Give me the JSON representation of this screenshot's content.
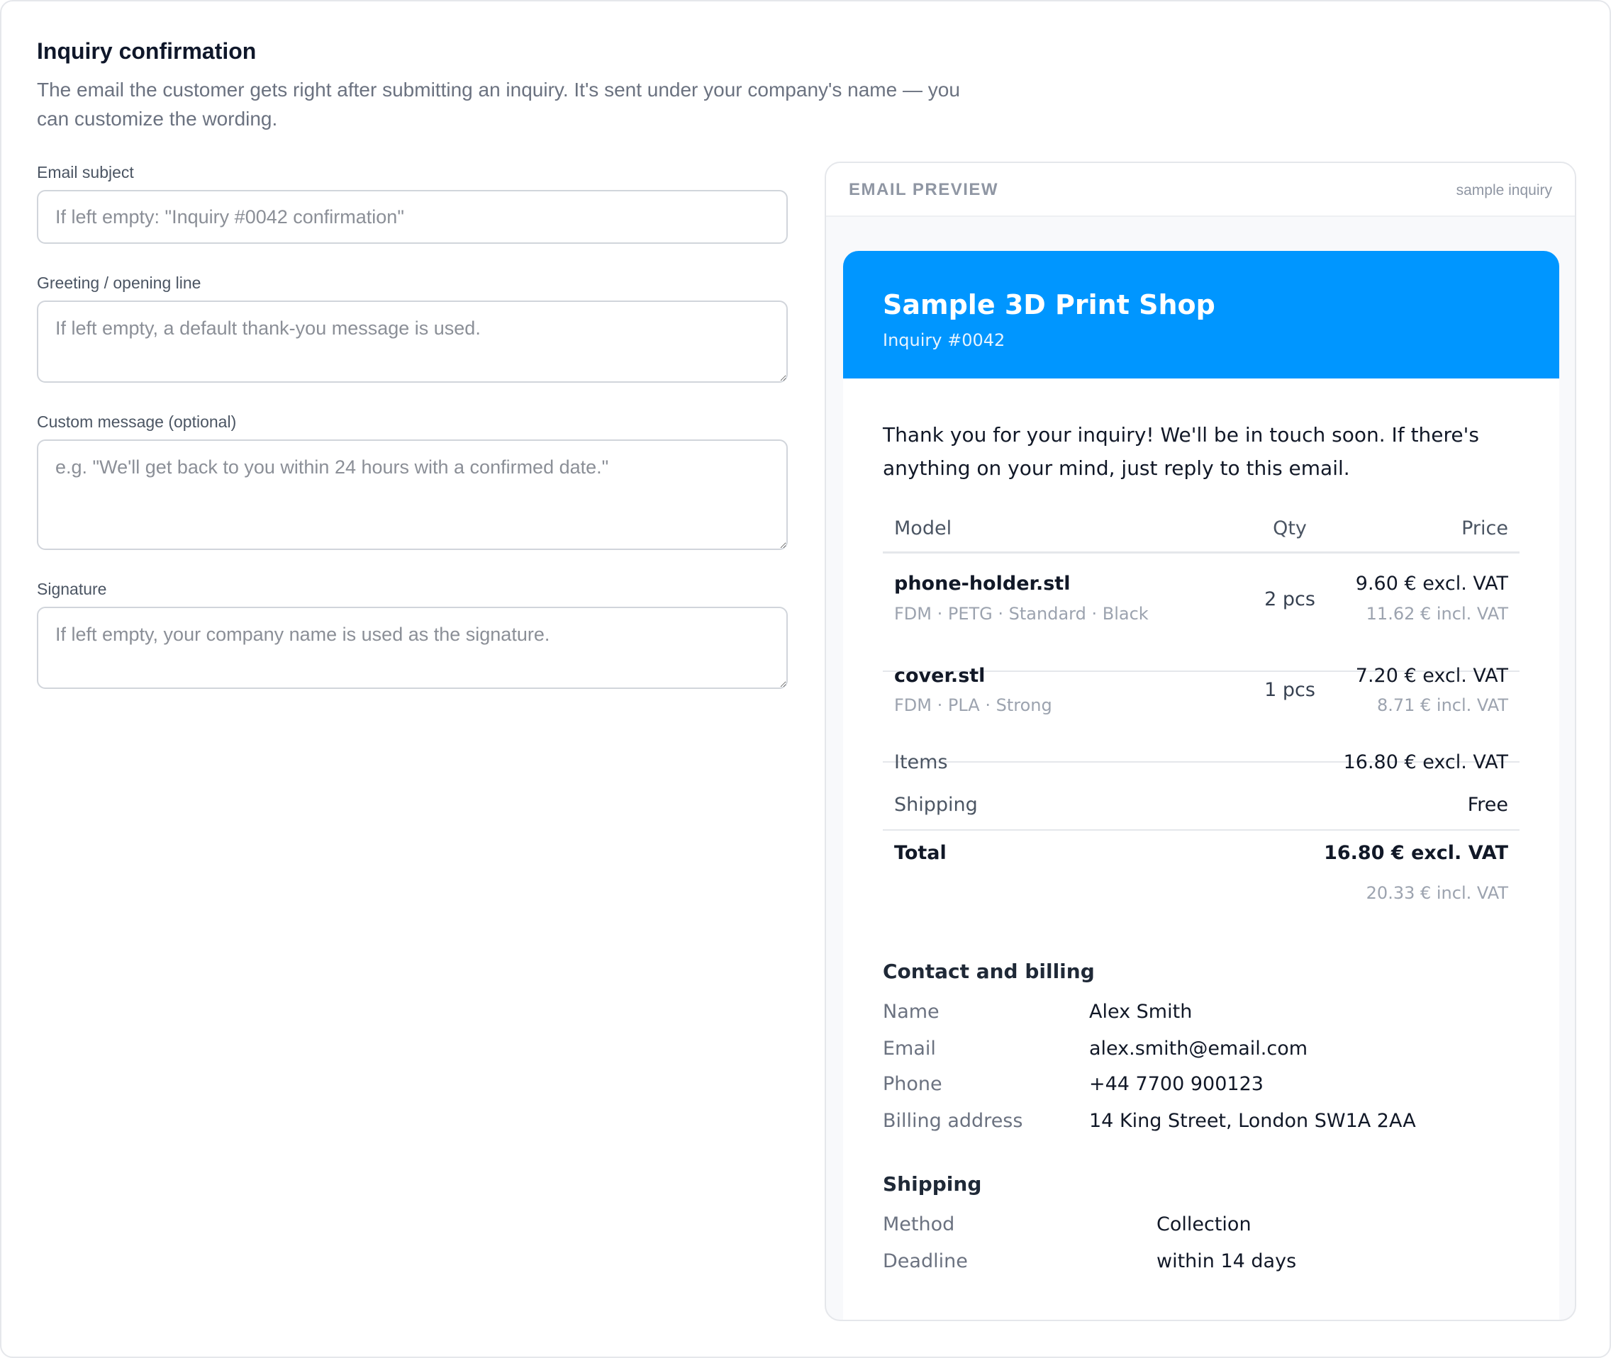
{
  "settings": {
    "title": "Inquiry confirmation",
    "description": "The email the customer gets right after submitting an inquiry. It's sent under your company's name — you can customize the wording.",
    "fields": {
      "subject": {
        "label": "Email subject",
        "value": "",
        "placeholder": "If left empty: \"Inquiry #0042 confirmation\""
      },
      "greeting": {
        "label": "Greeting / opening line",
        "value": "",
        "placeholder": "If left empty, a default thank-you message is used."
      },
      "custom_message": {
        "label": "Custom message (optional)",
        "value": "",
        "placeholder": "e.g. \"We'll get back to you within 24 hours with a confirmed date.\""
      },
      "signature": {
        "label": "Signature",
        "value": "",
        "placeholder": "If left empty, your company name is used as the signature."
      }
    }
  },
  "preview": {
    "title": "EMAIL PREVIEW",
    "tag": "sample inquiry",
    "email": {
      "brand_color": "#0096ff",
      "shop_name": "Sample 3D Print Shop",
      "inquiry_number": "Inquiry #0042",
      "intro": "Thank you for your inquiry! We'll be in touch soon. If there's anything on your mind, just reply to this email.",
      "table": {
        "headers": {
          "model": "Model",
          "qty": "Qty",
          "price": "Price"
        },
        "rows": [
          {
            "file": "phone-holder.stl",
            "meta": "FDM · PETG · Standard · Black",
            "qty": "2 pcs",
            "price_excl": "9.60 € excl. VAT",
            "price_incl": "11.62 € incl. VAT"
          },
          {
            "file": "cover.stl",
            "meta": "FDM · PLA · Strong",
            "qty": "1 pcs",
            "price_excl": "7.20 € excl. VAT",
            "price_incl": "8.71 € incl. VAT"
          }
        ]
      },
      "summary": {
        "items_label": "Items",
        "items_value": "16.80 € excl. VAT",
        "shipping_label": "Shipping",
        "shipping_value": "Free",
        "total_label": "Total",
        "total_excl": "16.80 € excl. VAT",
        "total_incl": "20.33 € incl. VAT"
      },
      "contact": {
        "heading": "Contact and billing",
        "name_label": "Name",
        "name": "Alex Smith",
        "email_label": "Email",
        "email": "alex.smith@email.com",
        "phone_label": "Phone",
        "phone": "+44 7700 900123",
        "address_label": "Billing address",
        "address": "14 King Street, London SW1A 2AA"
      },
      "shipping": {
        "heading": "Shipping",
        "method_label": "Method",
        "method": "Collection",
        "deadline_label": "Deadline",
        "deadline": "within 14 days"
      }
    }
  }
}
